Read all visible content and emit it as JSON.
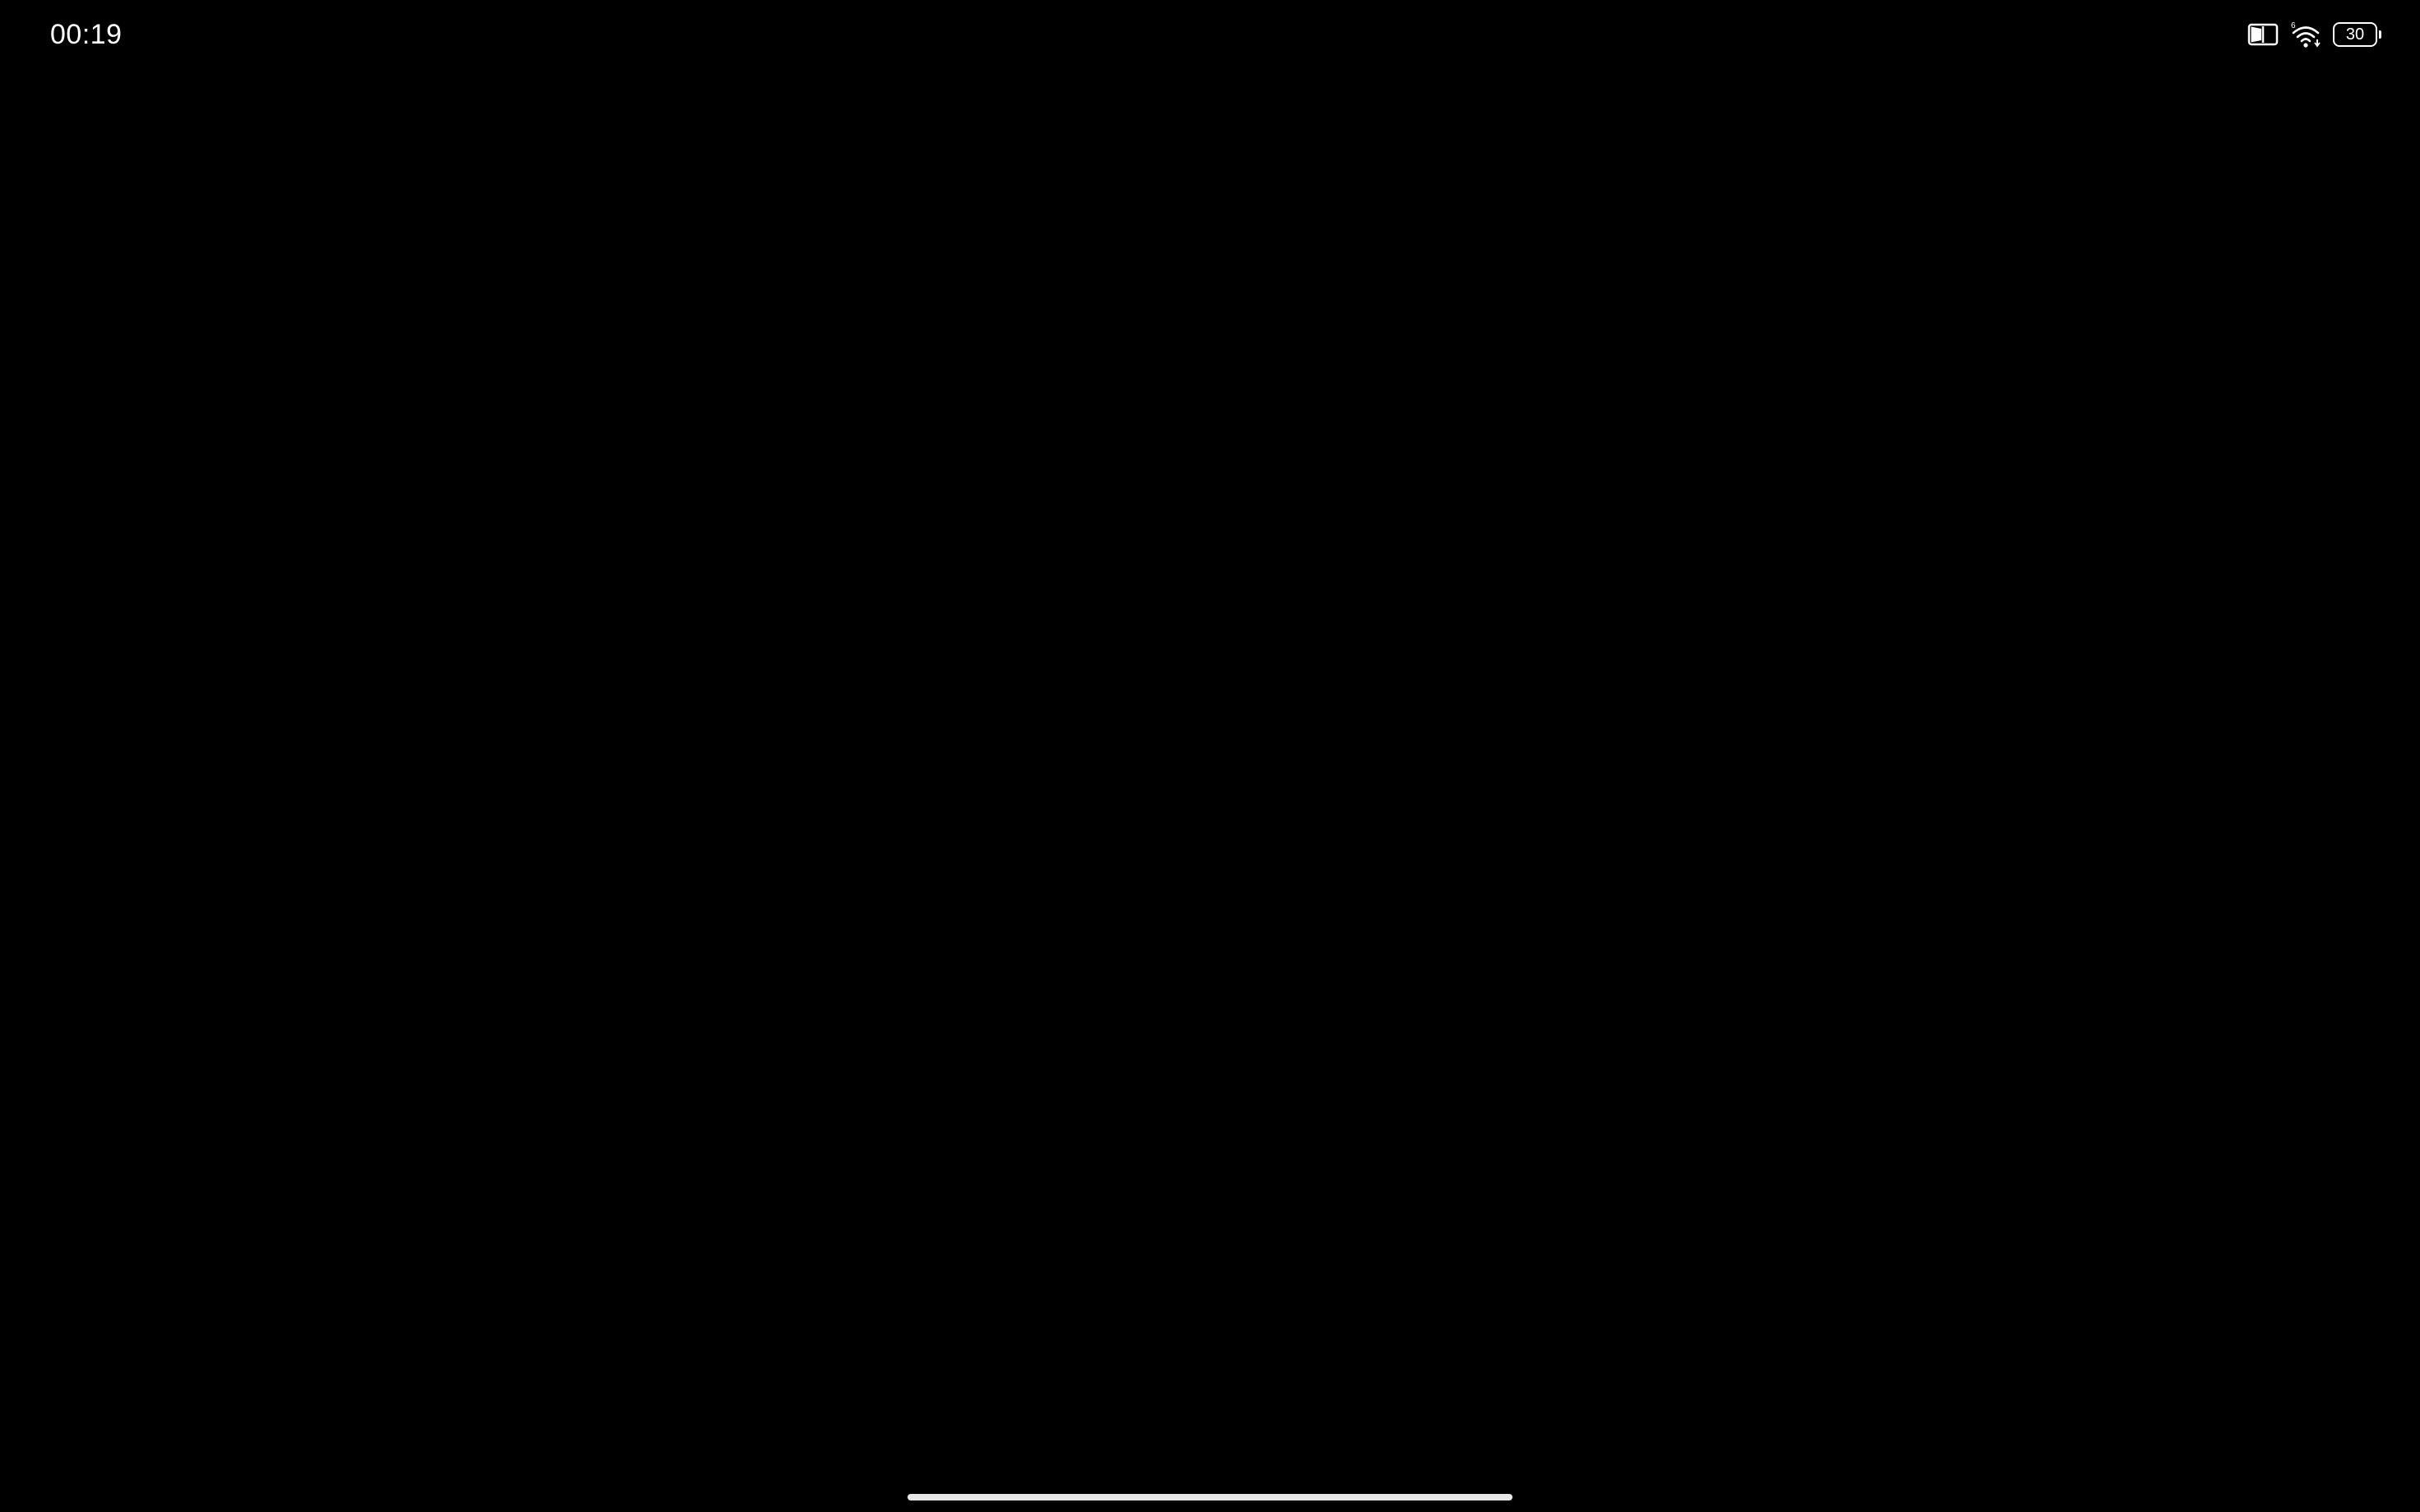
{
  "status_bar": {
    "time": "00:19",
    "icons": [
      "reading-mode-icon",
      "wifi-6-icon",
      "battery-icon"
    ],
    "battery_level": "30"
  },
  "colors": {
    "background": "#000000",
    "foreground": "#ffffff",
    "home_indicator": "#e8e8e8"
  }
}
